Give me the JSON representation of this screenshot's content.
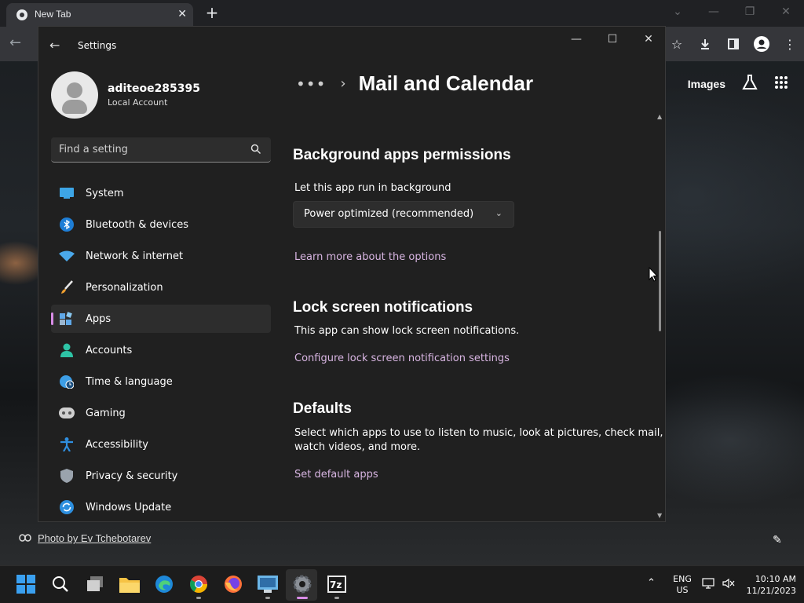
{
  "browser": {
    "tab_title": "New Tab",
    "ntp_images_link": "Images",
    "photo_credit": "Photo by Ev Tchebotarev"
  },
  "settings": {
    "window_title": "Settings",
    "user": {
      "name": "aditeoe285395",
      "account_type": "Local Account"
    },
    "search": {
      "placeholder": "Find a setting"
    },
    "nav": [
      {
        "label": "System",
        "icon": "monitor-icon"
      },
      {
        "label": "Bluetooth & devices",
        "icon": "bluetooth-icon"
      },
      {
        "label": "Network & internet",
        "icon": "wifi-icon"
      },
      {
        "label": "Personalization",
        "icon": "brush-icon"
      },
      {
        "label": "Apps",
        "icon": "apps-icon",
        "active": true
      },
      {
        "label": "Accounts",
        "icon": "person-icon"
      },
      {
        "label": "Time & language",
        "icon": "globe-clock-icon"
      },
      {
        "label": "Gaming",
        "icon": "gamepad-icon"
      },
      {
        "label": "Accessibility",
        "icon": "accessibility-icon"
      },
      {
        "label": "Privacy & security",
        "icon": "shield-icon"
      },
      {
        "label": "Windows Update",
        "icon": "update-icon"
      }
    ],
    "breadcrumb": {
      "ellipsis": "•••",
      "page_title": "Mail and Calendar"
    },
    "sections": {
      "background": {
        "heading": "Background apps permissions",
        "label": "Let this app run in background",
        "dropdown_value": "Power optimized (recommended)",
        "link": "Learn more about the options"
      },
      "lock_screen": {
        "heading": "Lock screen notifications",
        "text": "This app can show lock screen notifications.",
        "link": "Configure lock screen notification settings"
      },
      "defaults": {
        "heading": "Defaults",
        "text_line1": "Select which apps to use to listen to music, look at pictures, check mail,",
        "text_line2": "watch videos, and more.",
        "link": "Set default apps"
      }
    }
  },
  "taskbar": {
    "lang_line1": "ENG",
    "lang_line2": "US",
    "time": "10:10 AM",
    "date": "11/21/2023"
  },
  "colors": {
    "accent": "#d88ce6",
    "link": "#d8b5e2",
    "window_bg": "#202020"
  }
}
